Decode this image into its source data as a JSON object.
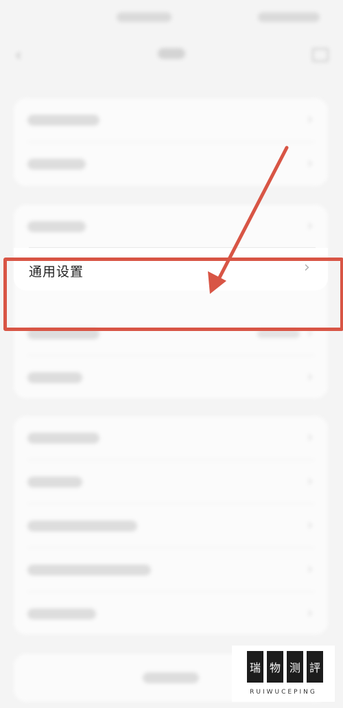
{
  "focused_item": {
    "label": "通用设置",
    "chevron": "›"
  },
  "watermark": {
    "chars": [
      "瑞",
      "物",
      "测",
      "評"
    ],
    "caption": "RUIWUCEPING"
  },
  "colors": {
    "highlight": "#d85545",
    "arrow": "#d85545"
  },
  "icons": {
    "back": "chevron-left-icon",
    "more": "more-icon",
    "row": "chevron-right-icon"
  }
}
